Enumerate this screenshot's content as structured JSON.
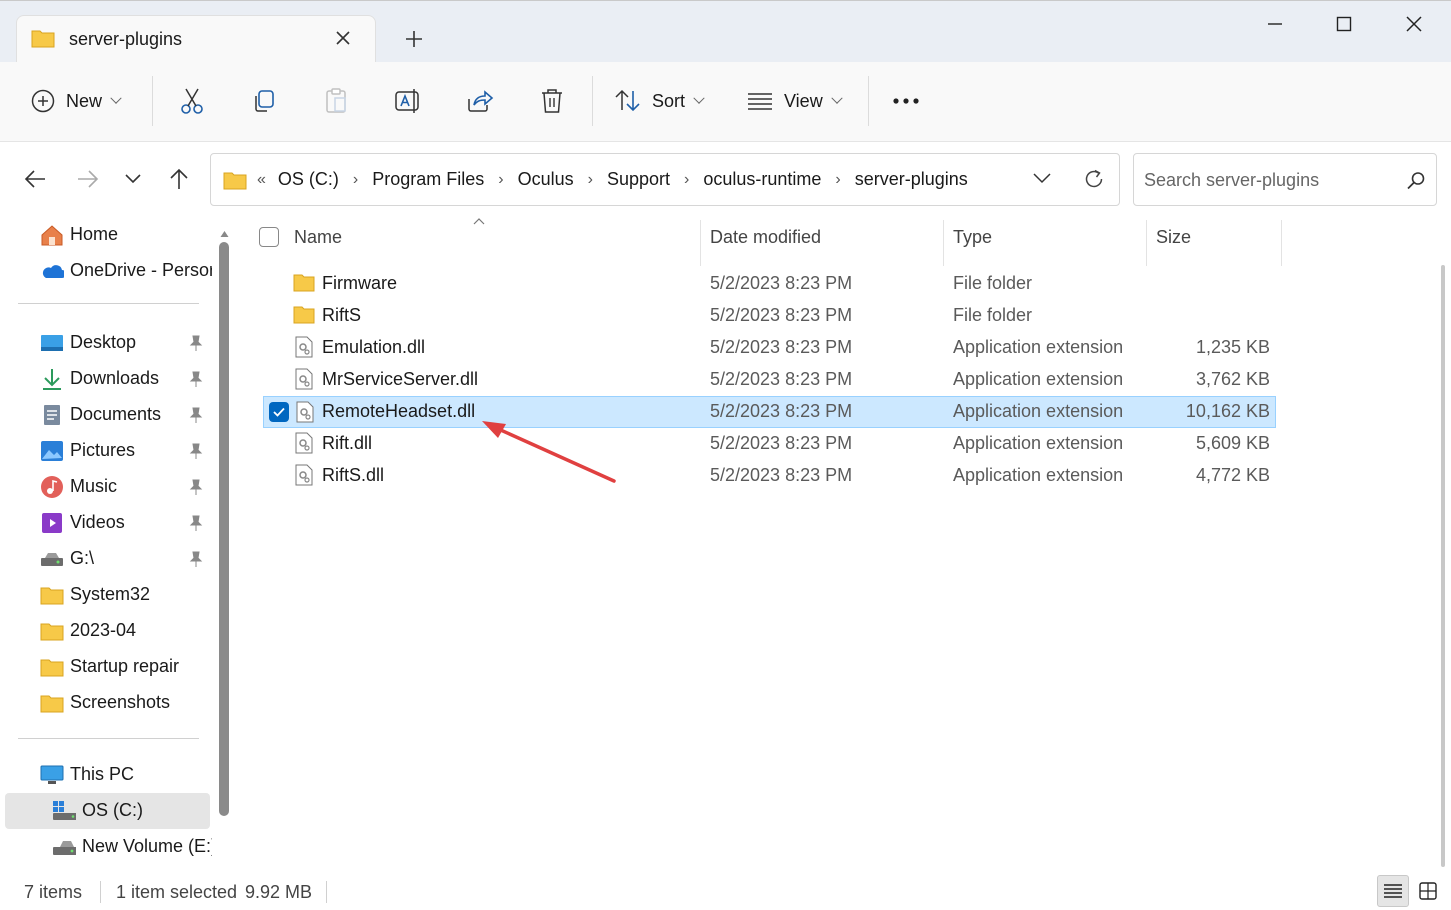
{
  "window": {
    "tab_title": "server-plugins"
  },
  "toolbar": {
    "new_label": "New",
    "sort_label": "Sort",
    "view_label": "View"
  },
  "address": {
    "overflow": "«",
    "crumbs": [
      "OS (C:)",
      "Program Files",
      "Oculus",
      "Support",
      "oculus-runtime",
      "server-plugins"
    ]
  },
  "search": {
    "placeholder": "Search server-plugins"
  },
  "sidebar": {
    "home": "Home",
    "onedrive": "OneDrive - Persor",
    "quick": [
      {
        "label": "Desktop",
        "icon": "desktop-icon"
      },
      {
        "label": "Downloads",
        "icon": "downloads-icon"
      },
      {
        "label": "Documents",
        "icon": "documents-icon"
      },
      {
        "label": "Pictures",
        "icon": "pictures-icon"
      },
      {
        "label": "Music",
        "icon": "music-icon"
      },
      {
        "label": "Videos",
        "icon": "videos-icon"
      },
      {
        "label": "G:\\",
        "icon": "drive-icon"
      },
      {
        "label": "System32",
        "icon": "folder-icon"
      },
      {
        "label": "2023-04",
        "icon": "folder-icon"
      },
      {
        "label": "Startup repair",
        "icon": "folder-icon"
      },
      {
        "label": "Screenshots",
        "icon": "folder-icon"
      }
    ],
    "this_pc": "This PC",
    "drives": [
      "OS (C:)",
      "New Volume (E:)"
    ]
  },
  "columns": {
    "name": "Name",
    "date": "Date modified",
    "type": "Type",
    "size": "Size"
  },
  "files": [
    {
      "name": "Firmware",
      "date": "5/2/2023 8:23 PM",
      "type": "File folder",
      "size": "",
      "kind": "folder"
    },
    {
      "name": "RiftS",
      "date": "5/2/2023 8:23 PM",
      "type": "File folder",
      "size": "",
      "kind": "folder"
    },
    {
      "name": "Emulation.dll",
      "date": "5/2/2023 8:23 PM",
      "type": "Application extension",
      "size": "1,235 KB",
      "kind": "dll"
    },
    {
      "name": "MrServiceServer.dll",
      "date": "5/2/2023 8:23 PM",
      "type": "Application extension",
      "size": "3,762 KB",
      "kind": "dll"
    },
    {
      "name": "RemoteHeadset.dll",
      "date": "5/2/2023 8:23 PM",
      "type": "Application extension",
      "size": "10,162 KB",
      "kind": "dll",
      "selected": true
    },
    {
      "name": "Rift.dll",
      "date": "5/2/2023 8:23 PM",
      "type": "Application extension",
      "size": "5,609 KB",
      "kind": "dll"
    },
    {
      "name": "RiftS.dll",
      "date": "5/2/2023 8:23 PM",
      "type": "Application extension",
      "size": "4,772 KB",
      "kind": "dll"
    }
  ],
  "status": {
    "items": "7 items",
    "selected": "1 item selected",
    "size": "9.92 MB"
  },
  "colors": {
    "accent": "#0067c0",
    "selection": "#cce8ff",
    "arrow": "#e04040",
    "folder": "#f7c948"
  }
}
